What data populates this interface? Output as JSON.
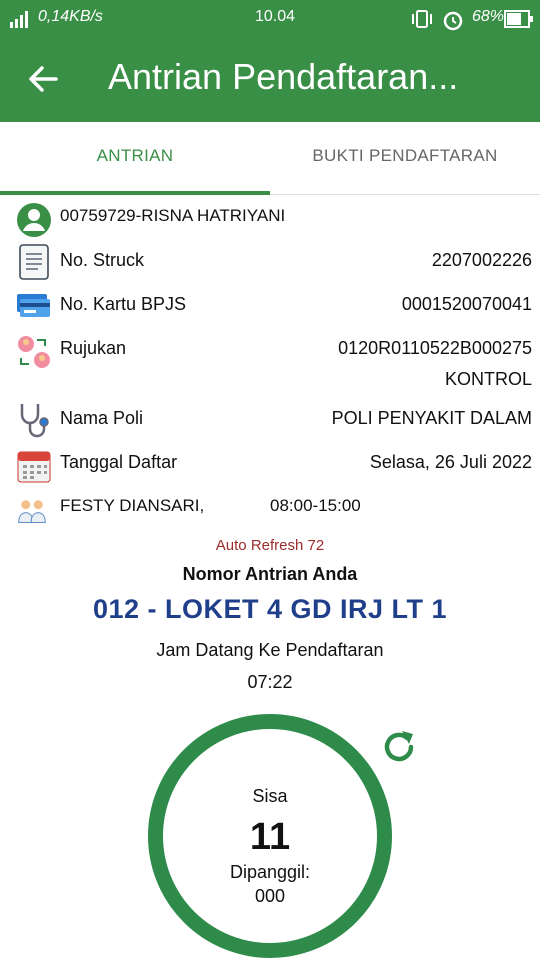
{
  "status_bar": {
    "network_speed": "0,14KB/s",
    "time": "10.04",
    "battery": "68%"
  },
  "appbar": {
    "title": "Antrian Pendaftaran..."
  },
  "tabs": [
    {
      "label": "ANTRIAN",
      "active": true
    },
    {
      "label": "BUKTI PENDAFTARAN",
      "active": false
    }
  ],
  "patient": {
    "name": "00759729-RISNA HATRIYANI"
  },
  "details": {
    "struck": {
      "label": "No. Struck",
      "value": "2207002226"
    },
    "bpjs": {
      "label": "No. Kartu BPJS",
      "value": "0001520070041"
    },
    "rujukan": {
      "label": "Rujukan",
      "value": "0120R0110522B000275",
      "value2": "KONTROL"
    },
    "poli": {
      "label": "Nama Poli",
      "value": "POLI PENYAKIT DALAM"
    },
    "tanggal": {
      "label": "Tanggal Daftar",
      "value": "Selasa, 26 Juli 2022"
    },
    "dokter": {
      "name": "FESTY DIANSARI,",
      "hours": "08:00-15:00"
    }
  },
  "queue": {
    "auto_refresh": "Auto Refresh 72",
    "heading": "Nomor Antrian Anda",
    "number": "012 - LOKET 4 GD IRJ LT 1",
    "arrival_label": "Jam Datang Ke Pendaftaran",
    "arrival_time": "07:22",
    "sisa_label": "Sisa",
    "sisa_value": "11",
    "called_label": "Dipanggil:",
    "called_value": "000"
  },
  "colors": {
    "primary": "#3a8f47",
    "ring": "#2e8b4a",
    "queue_number": "#1f3f8a",
    "auto_refresh": "#9b2c2c"
  },
  "icons": {
    "back": "arrow-left-icon",
    "avatar": "person-avatar-icon",
    "struck": "receipt-icon",
    "bpjs": "id-cards-icon",
    "rujukan": "referral-swap-icon",
    "poli": "stethoscope-icon",
    "tanggal": "calendar-icon",
    "dokter": "doctors-icon",
    "refresh": "refresh-icon"
  }
}
